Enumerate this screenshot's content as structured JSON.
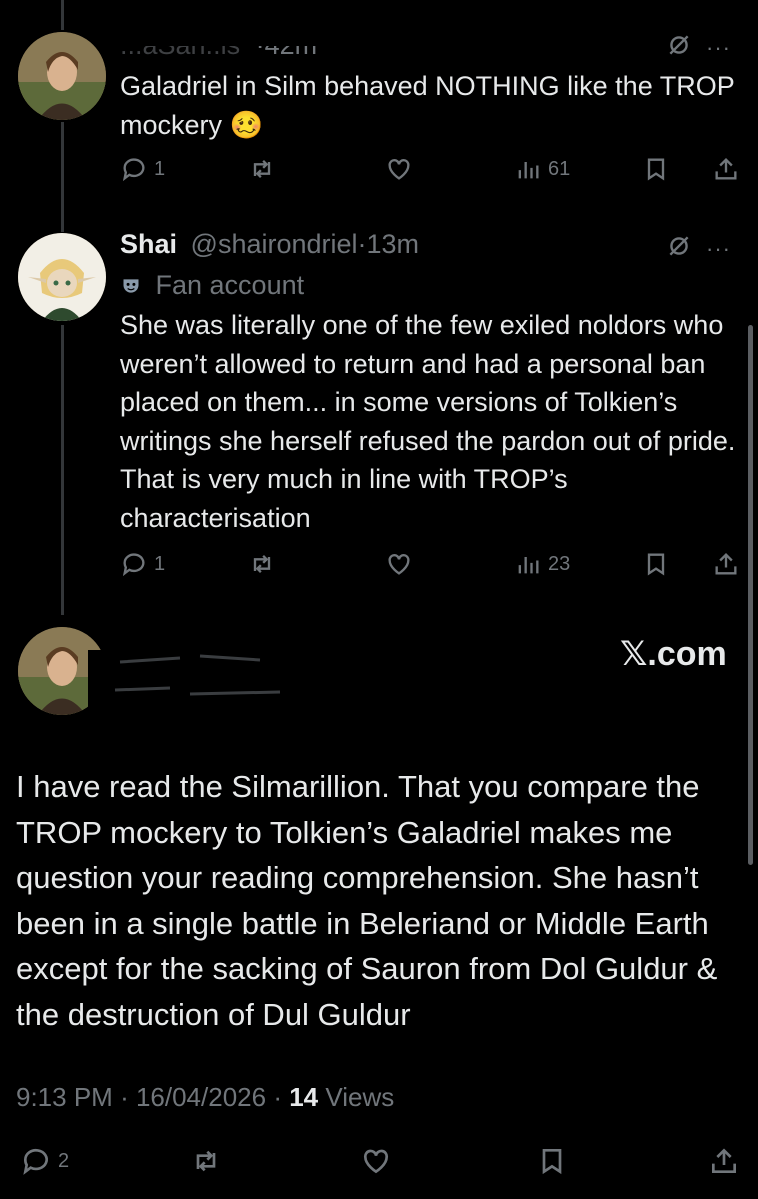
{
  "tweet1": {
    "handle_partial": "...aSan..is",
    "time": "·42m",
    "text": "Galadriel in Silm behaved NOTHING like the TROP mockery 🥴",
    "replies": "1",
    "views": "61"
  },
  "tweet2": {
    "name": "Shai",
    "handle": "@shairondriel",
    "time": "·13m",
    "badge_icon": "mask-icon",
    "badge_text": "Fan account",
    "text": "She was literally one of the few exiled noldors who weren’t allowed to return and had a personal ban placed on them... in some versions of Tolkien’s writings she herself refused the pardon out of pride. That is very much in line with TROP’s characterisation",
    "replies": "1",
    "views": "23"
  },
  "main_tweet": {
    "watermark": "𝕏.com",
    "text": "I have read the Silmarillion. That you compare the TROP mockery to Tolkien’s Galadriel makes me question your reading comprehension. She hasn’t been in a single battle in Beleriand or Middle Earth except for the sacking of Sauron from Dol Guldur & the destruction of Dul Guldur",
    "time": "9:13 PM",
    "date": "16/04/2026",
    "views_count": "14",
    "views_label": "Views",
    "replies": "2"
  },
  "colors": {
    "background": "#000000",
    "text": "#e7e9ea",
    "muted": "#71767b"
  }
}
